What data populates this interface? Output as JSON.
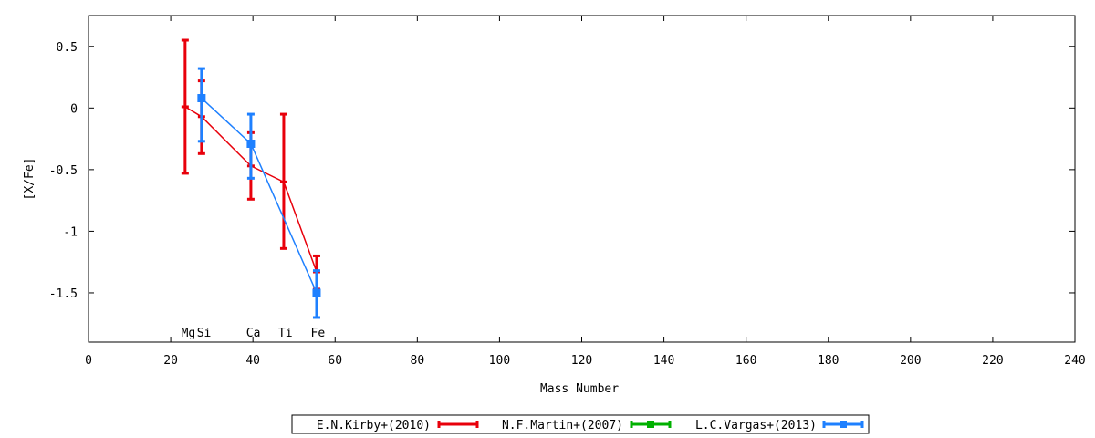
{
  "chart_data": {
    "type": "scatter",
    "title": "",
    "xlabel": "Mass Number",
    "ylabel": "[X/Fe]",
    "xlim": [
      0,
      240
    ],
    "ylim": [
      -1.9,
      0.75
    ],
    "xticks": [
      0,
      20,
      40,
      60,
      80,
      100,
      120,
      140,
      160,
      180,
      200,
      220,
      240
    ],
    "yticks": [
      0.5,
      0,
      -0.5,
      -1,
      -1.5
    ],
    "ytick_labels": [
      "0.5",
      "0",
      "-0.5",
      "-1",
      "-1.5"
    ],
    "element_labels": [
      {
        "label": "Mg",
        "x": 24.3
      },
      {
        "label": "Si",
        "x": 28.1
      },
      {
        "label": "Ca",
        "x": 40.1
      },
      {
        "label": "Ti",
        "x": 47.9
      },
      {
        "label": "Fe",
        "x": 55.8
      }
    ],
    "legend_position": "bottom",
    "series": [
      {
        "name": "E.N.Kirby+(2010)",
        "color": "#e8000b",
        "marker": "dash",
        "points": [
          {
            "x": 23.5,
            "y": 0.01,
            "lo": -0.53,
            "hi": 0.55
          },
          {
            "x": 27.5,
            "y": -0.07,
            "lo": -0.37,
            "hi": 0.22
          },
          {
            "x": 39.5,
            "y": -0.47,
            "lo": -0.74,
            "hi": -0.2
          },
          {
            "x": 47.5,
            "y": -0.6,
            "lo": -1.14,
            "hi": -0.05
          },
          {
            "x": 55.5,
            "y": -1.33,
            "lo": -1.47,
            "hi": -1.2
          }
        ]
      },
      {
        "name": "N.F.Martin+(2007)",
        "color": "#00b000",
        "marker": "square",
        "points": []
      },
      {
        "name": "L.C.Vargas+(2013)",
        "color": "#1e80ff",
        "marker": "square",
        "points": [
          {
            "x": 27.5,
            "y": 0.08,
            "lo": -0.27,
            "hi": 0.32
          },
          {
            "x": 39.5,
            "y": -0.29,
            "lo": -0.57,
            "hi": -0.05
          },
          {
            "x": 55.5,
            "y": -1.5,
            "lo": -1.7,
            "hi": -1.32
          }
        ]
      }
    ]
  }
}
